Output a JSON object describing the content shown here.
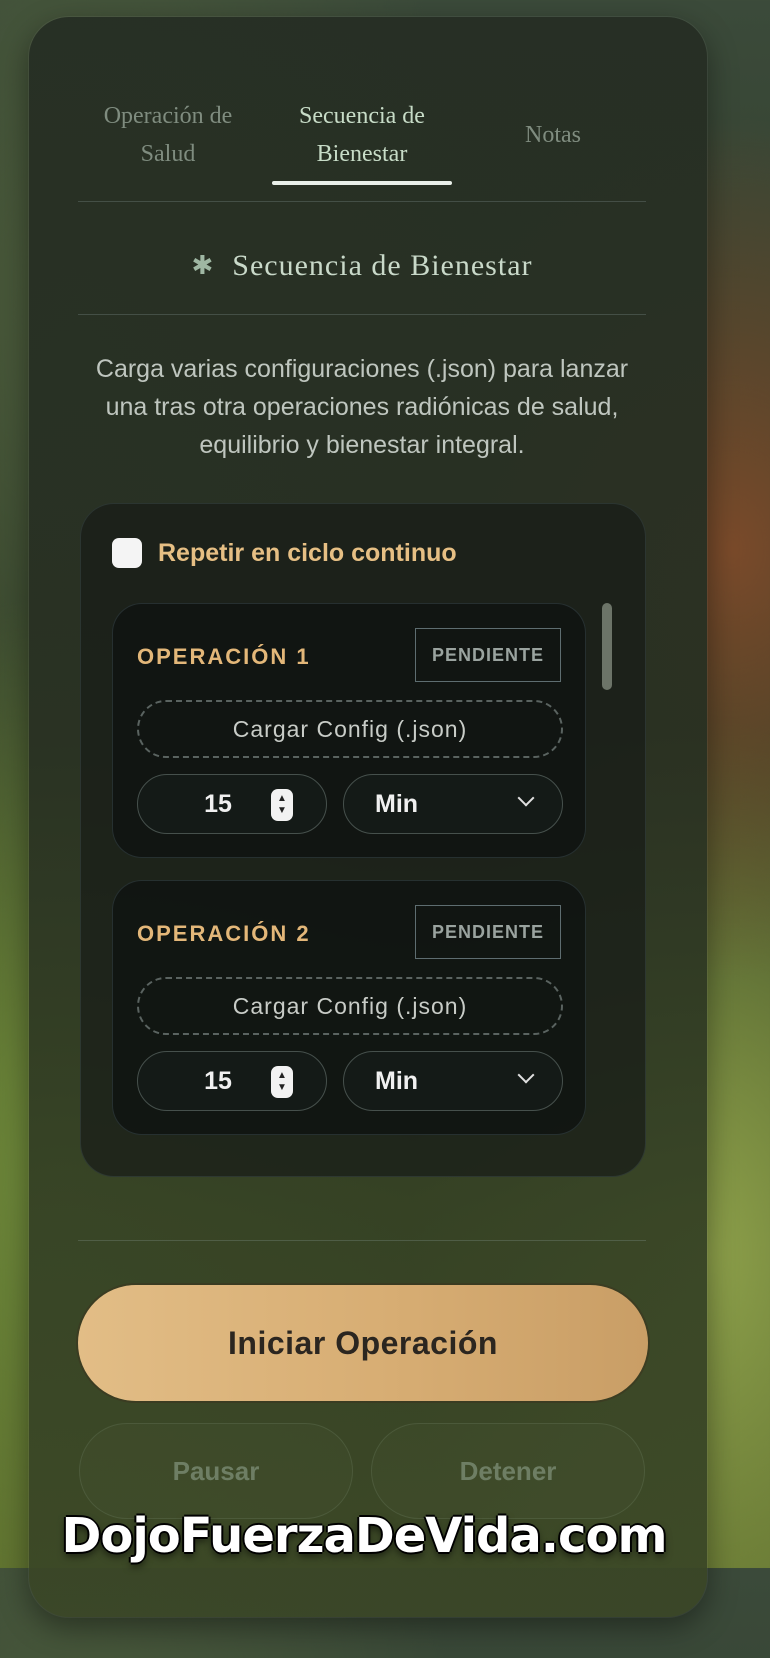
{
  "tabs": [
    {
      "label": "Operación de Salud"
    },
    {
      "label": "Secuencia de Bienestar"
    },
    {
      "label": "Notas"
    }
  ],
  "section": {
    "icon": "sparkle-icon",
    "title": "Secuencia de Bienestar",
    "description": "Carga varias configuraciones (.json) para lanzar una tras otra operaciones radiónicas de salud, equilibrio y bienestar integral."
  },
  "repeat": {
    "label": "Repetir en ciclo continuo",
    "checked": false
  },
  "operations": [
    {
      "title": "OPERACIÓN 1",
      "status": "PENDIENTE",
      "load_label": "Cargar Config (.json)",
      "duration": "15",
      "unit": "Min"
    },
    {
      "title": "OPERACIÓN 2",
      "status": "PENDIENTE",
      "load_label": "Cargar Config (.json)",
      "duration": "15",
      "unit": "Min"
    }
  ],
  "actions": {
    "start": "Iniciar Operación",
    "pause": "Pausar",
    "stop": "Detener"
  },
  "watermark": "DojoFuerzaDeVida.com",
  "colors": {
    "accent_gold": "#e2bd86",
    "label_gold": "#e6bf84",
    "active_tab": "#c7dcc7"
  }
}
